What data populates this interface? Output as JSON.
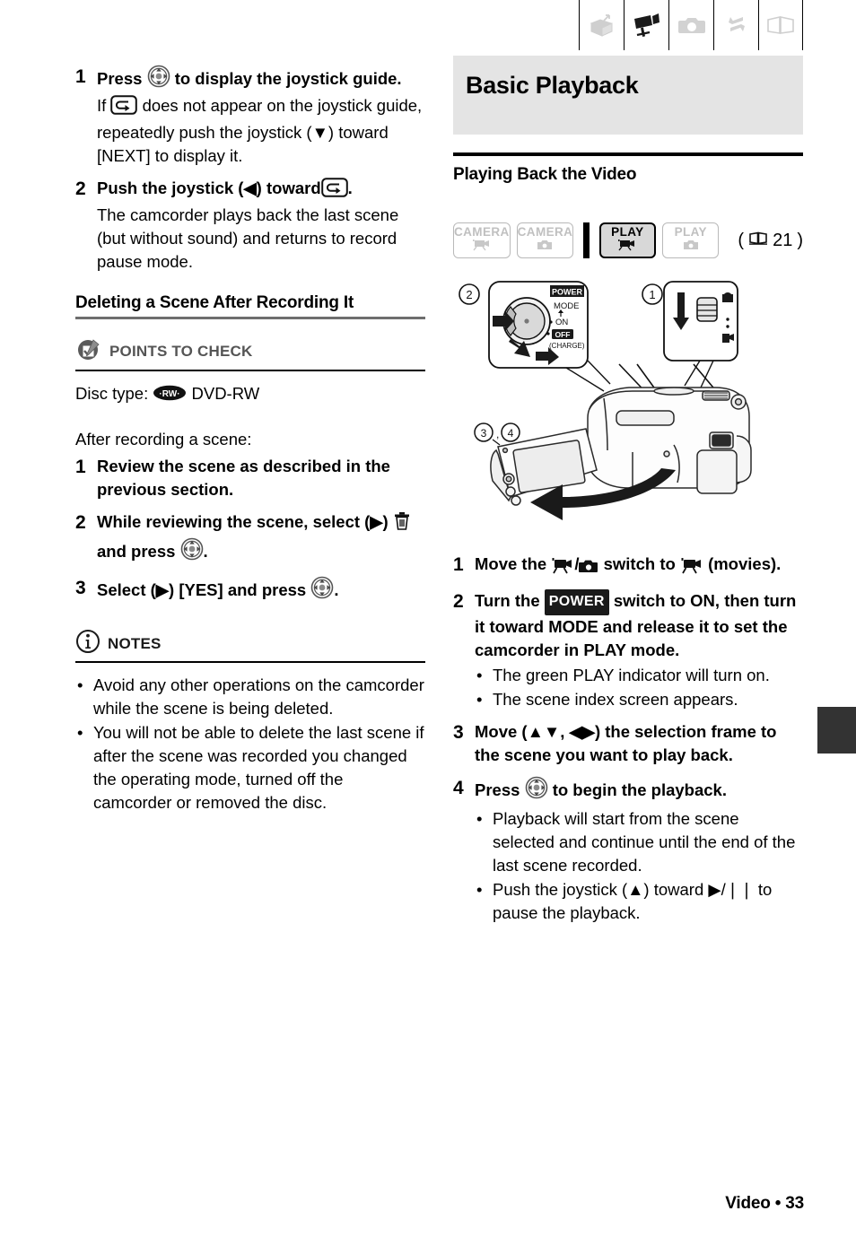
{
  "top_tabs": [
    {
      "name": "intro-box-icon",
      "label": "Introduction",
      "active": false
    },
    {
      "name": "video-camcorder-icon",
      "label": "Video",
      "active": true
    },
    {
      "name": "photo-camera-icon",
      "label": "Photos",
      "active": false
    },
    {
      "name": "transfer-arrows-icon",
      "label": "Transfer",
      "active": false
    },
    {
      "name": "open-book-icon",
      "label": "Additional Information",
      "active": false
    }
  ],
  "left": {
    "step1": {
      "num": "1",
      "head_before": "Press",
      "head_after": "to display the joystick guide.",
      "sub_before": "If",
      "sub_after": "does not appear on the joystick guide, repeatedly push the joystick (▼) toward [NEXT] to display it."
    },
    "step2": {
      "num": "2",
      "head_before": "Push the joystick (◀) toward",
      "head_after": ".",
      "sub": "The camcorder plays back the last scene (but without sound) and returns to record pause mode."
    },
    "subhead": "Deleting a Scene After Recording It",
    "points_to_check": {
      "label": "POINTS TO CHECK",
      "disc_type_label": "Disc type:",
      "disc_badge": "RW",
      "disc_value": "DVD-RW"
    },
    "after_recording": "After recording a scene:",
    "steps": [
      {
        "num": "1",
        "text": "Review the scene as described in the previous section."
      },
      {
        "num": "2",
        "before": "While reviewing the scene, select (▶)",
        "mid": "and press",
        "after": "."
      },
      {
        "num": "3",
        "before": "Select (▶) [YES] and press",
        "after": "."
      }
    ],
    "notes": {
      "label": "NOTES",
      "items": [
        "Avoid any other operations on the camcorder while the scene is being deleted.",
        "You will not be able to delete the last scene if after the scene was recorded you changed the operating mode, turned off the camcorder or removed the disc."
      ]
    }
  },
  "right": {
    "section_title": "Basic Playback",
    "section_subtitle": "Playing Back the Video",
    "mode_badges": [
      {
        "title": "CAMERA",
        "icon": "movie-icon",
        "active": false
      },
      {
        "title": "CAMERA",
        "icon": "photo-icon",
        "active": false
      },
      {
        "title": "PLAY",
        "icon": "movie-icon",
        "active": true
      },
      {
        "title": "PLAY",
        "icon": "photo-icon",
        "active": false
      }
    ],
    "page_ref": "21",
    "illustration": {
      "callout_power": {
        "marker": "2",
        "power_label": "POWER",
        "mode_label": "MODE",
        "on_label": "ON",
        "off_label": "OFF",
        "charge_label": "(CHARGE)"
      },
      "callout_switch": {
        "marker": "1"
      },
      "lcd_markers": "3 , 4"
    },
    "steps": [
      {
        "num": "1",
        "before": "Move the",
        "mid": "/",
        "after": "switch to",
        "tail": "(movies)."
      },
      {
        "num": "2",
        "before": "Turn the",
        "badge": "POWER",
        "after": "switch to ON, then turn it toward MODE and release it to set the camcorder in PLAY mode.",
        "bullets": [
          "The green PLAY indicator will turn on.",
          "The scene index screen appears."
        ]
      },
      {
        "num": "3",
        "text": "Move (▲▼, ◀▶) the selection frame to the scene you want to play back."
      },
      {
        "num": "4",
        "before": "Press",
        "after": "to begin the playback.",
        "bullets": [
          "Playback will start from the scene selected and continue until the end of the last scene recorded.",
          "Push the joystick (▲) toward ▶/❘❘ to pause the playback."
        ]
      }
    ]
  },
  "footer": "Video • 33"
}
